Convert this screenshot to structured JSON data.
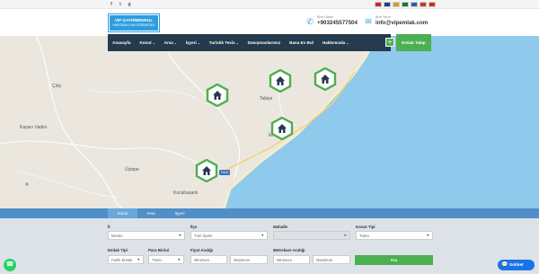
{
  "topbar": {
    "social_icons": [
      "facebook-icon",
      "twitter-icon",
      "google-plus-icon"
    ],
    "social_glyphs": [
      "f",
      "t",
      "g"
    ],
    "flags": [
      {
        "name": "flag-tr",
        "color": "#d9232b"
      },
      {
        "name": "flag-gb",
        "color": "#1f3f8c"
      },
      {
        "name": "flag-de",
        "color": "#d4a017"
      },
      {
        "name": "flag-sa",
        "color": "#0b7a3a"
      },
      {
        "name": "flag-ru",
        "color": "#3259a8"
      },
      {
        "name": "flag-nl",
        "color": "#c0392b"
      },
      {
        "name": "flag-ru2",
        "color": "#d52b1e"
      }
    ]
  },
  "header": {
    "logo_line1": "VIP GAYRİMENKUL",
    "logo_line2": "HARİTADA İLAN GÖRÜNTÜLE",
    "phone_label": "Bize Ulaşın",
    "phone_value": "+903245577504",
    "email_label": "Bize Yazın",
    "email_value": "info@vipemlak.com"
  },
  "nav": {
    "items": [
      {
        "label": "Anasayfa",
        "dropdown": false
      },
      {
        "label": "Konut",
        "dropdown": true
      },
      {
        "label": "Arsa",
        "dropdown": true
      },
      {
        "label": "İşyeri",
        "dropdown": true
      },
      {
        "label": "Turistik Tesis",
        "dropdown": true
      },
      {
        "label": "Danışmanlarımız",
        "dropdown": false
      },
      {
        "label": "Bana Ev Bul",
        "dropdown": false
      },
      {
        "label": "Hakkımızda",
        "dropdown": true
      }
    ],
    "plus_label": "+",
    "request_label": "Emlak Talep"
  },
  "map": {
    "labels": [
      "Çiriş",
      "Tabiye",
      "Kayacı Vadisi",
      "Üçtepe",
      "Kocahasanlı",
      "Er",
      "D400"
    ],
    "pins": 5,
    "colors": {
      "land": "#ebe7df",
      "sea": "#8fc9ec",
      "pin_border": "#4caf50",
      "pin_icon": "#253a4d"
    }
  },
  "search": {
    "tabs": [
      "Konut",
      "Arsa",
      "İşyeri"
    ],
    "active_tab": "Konut",
    "fields": {
      "il_label": "İl",
      "il_value": "Mersin",
      "ilce_label": "İlçe",
      "ilce_value": "Tüm İlçeler",
      "mahalle_label": "Mahalle",
      "mahalle_value": "",
      "konut_tipi_label": "Konut Tipi",
      "konut_tipi_value": "Tümü",
      "emlak_tipi_label": "Emlak Tipi",
      "emlak_tipi_value": "Farklı Emlak",
      "para_birimi_label": "Para Birimi",
      "para_birimi_value": "Tümü",
      "fiyat_label": "Fiyat Aralığı",
      "fiyat_min": "Minimum",
      "fiyat_max": "Maximum",
      "metrekare_label": "Metrekare Aralığı",
      "metrekare_min": "Minimum",
      "metrekare_max": "Maximum"
    },
    "button": "Ara"
  },
  "chat": {
    "label": "Sohbet"
  }
}
